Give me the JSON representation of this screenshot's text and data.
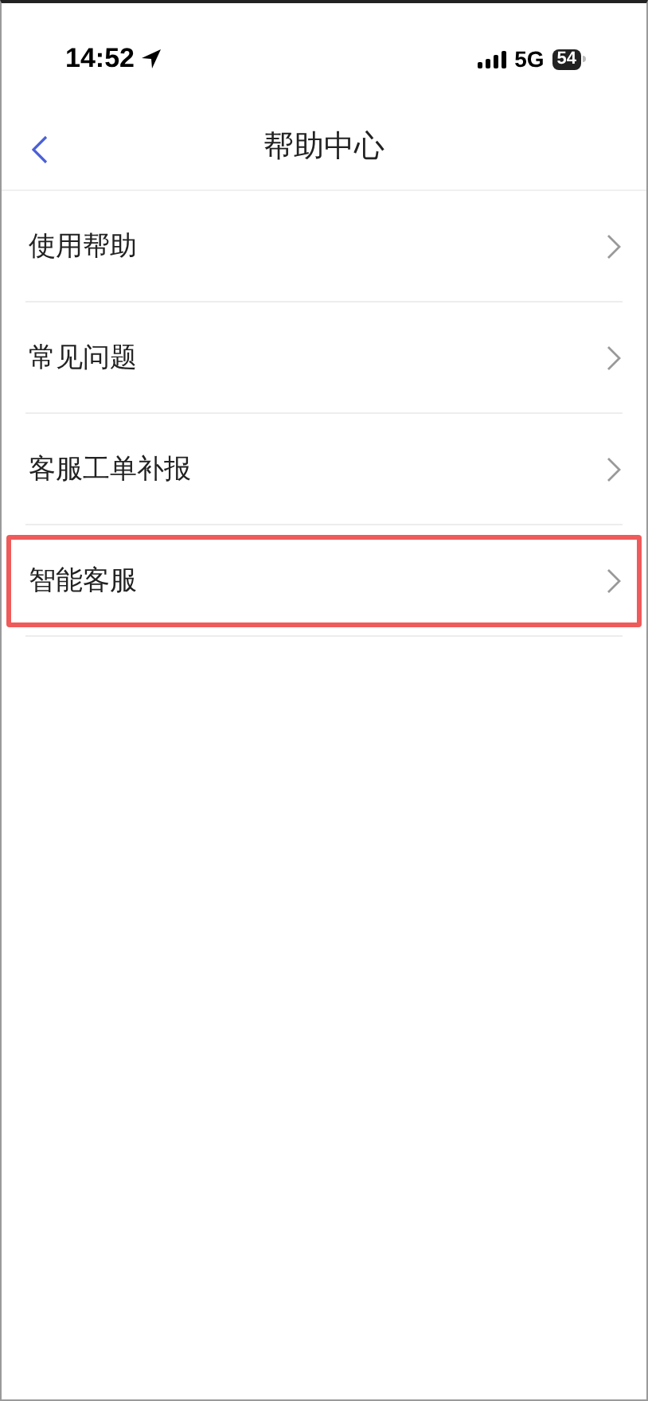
{
  "status_bar": {
    "time": "14:52",
    "network": "5G",
    "battery": "54"
  },
  "nav": {
    "title": "帮助中心"
  },
  "items": [
    {
      "label": "使用帮助",
      "highlighted": false
    },
    {
      "label": "常见问题",
      "highlighted": false
    },
    {
      "label": "客服工单补报",
      "highlighted": false
    },
    {
      "label": "智能客服",
      "highlighted": true
    }
  ]
}
